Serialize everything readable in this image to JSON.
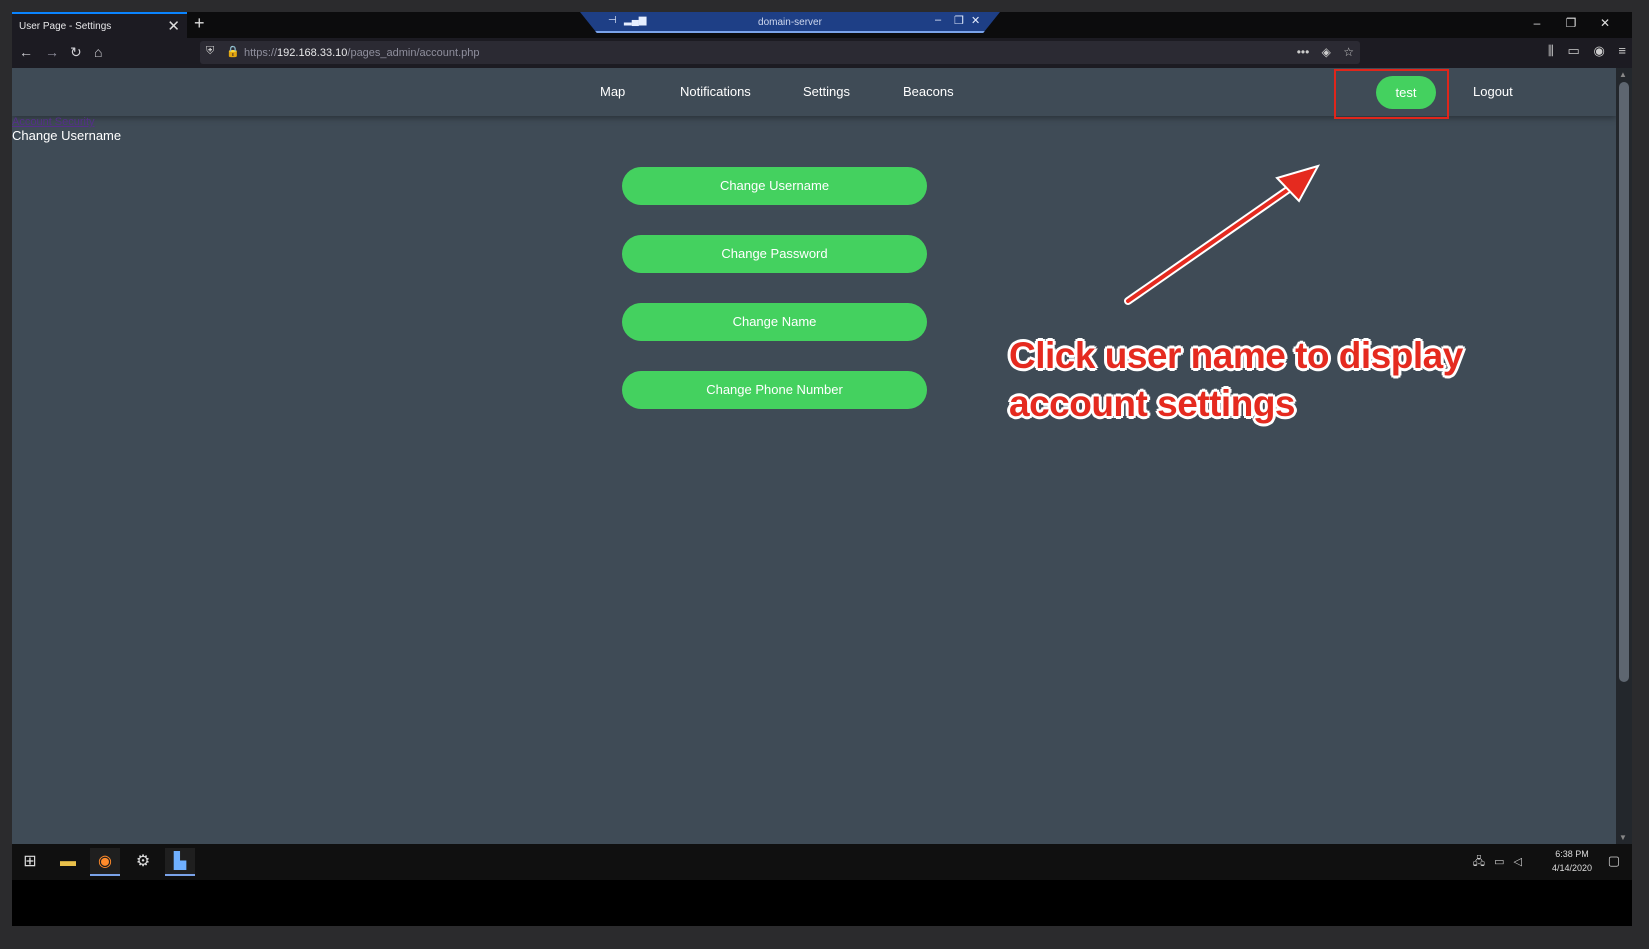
{
  "browser": {
    "tab_title": "User Page - Settings",
    "tab_close": "✕",
    "new_tab": "+",
    "url_prefix": "https://",
    "url_host": "192.168.33.10",
    "url_path": "/pages_admin/account.php"
  },
  "remote_session": {
    "name": "domain-server"
  },
  "site": {
    "nav": [
      "Map",
      "Notifications",
      "Settings",
      "Beacons"
    ],
    "user": "test",
    "logout": "Logout",
    "breadcrumb": "Account Security",
    "subtitle": "Change Username",
    "buttons": [
      "Change Username",
      "Change Password",
      "Change Name",
      "Change Phone Number"
    ],
    "colors": {
      "background": "#3f4b56",
      "button": "#44d15f",
      "highlight": "#e0261b"
    }
  },
  "annotation": {
    "line1": "Click user name to display",
    "line2": "account settings"
  },
  "taskbar": {
    "time": "6:38 PM",
    "date": "4/14/2020",
    "icons": [
      "windows-start-icon",
      "file-explorer-icon",
      "firefox-icon",
      "server-manager-icon",
      "remote-desktop-icon"
    ]
  }
}
